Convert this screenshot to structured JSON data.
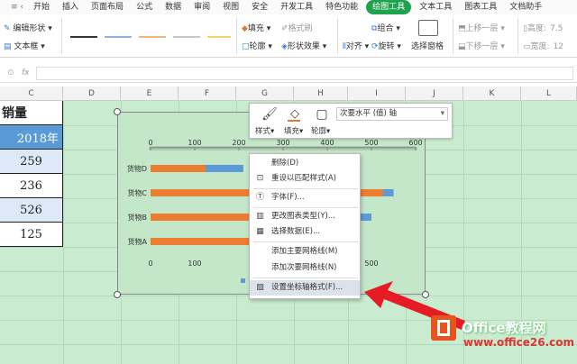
{
  "tabs": [
    "开始",
    "插入",
    "页面布局",
    "公式",
    "数据",
    "审阅",
    "视图",
    "安全",
    "开发工具",
    "特色功能",
    "绘图工具",
    "文本工具",
    "图表工具",
    "文档助手"
  ],
  "ribbon": {
    "edit_shape": "编辑形状",
    "text_box": "文本框",
    "fill": "填充",
    "format_brush": "格式刷",
    "outline": "轮廓",
    "shape_effects": "形状效果",
    "align": "对齐",
    "group": "组合",
    "rotate": "旋转",
    "selection_pane": "选择窗格",
    "bring_forward": "上移一层",
    "send_backward": "下移一层",
    "height_label": "高度:",
    "width_label": "宽度:",
    "height_val": "7.5",
    "width_val": "12"
  },
  "formula_bar": {
    "fx": "fx",
    "value": ""
  },
  "columns": [
    "C",
    "D",
    "E",
    "F",
    "G",
    "H",
    "I",
    "J",
    "K",
    "L"
  ],
  "sheet": {
    "header_partial": "销量",
    "year_header": "2018年",
    "values": [
      "259",
      "236",
      "526",
      "125"
    ]
  },
  "toolbar": {
    "style": "样式",
    "fill": "填充",
    "outline": "轮廓",
    "dropdown_value": "次要水平 (值) 轴"
  },
  "chart_data": {
    "type": "bar",
    "categories": [
      "货物D",
      "货物C",
      "货物B",
      "货物A"
    ],
    "series": [
      {
        "values": [
          125,
          526,
          236,
          259
        ],
        "color": "#ed7d31"
      },
      {
        "values": [
          210,
          550,
          500,
          0
        ],
        "color": "#5b9bd5"
      }
    ],
    "top_axis_ticks": [
      "0",
      "100",
      "200",
      "300",
      "400",
      "500",
      "600"
    ],
    "bottom_axis_ticks": [
      "0",
      "100",
      "500"
    ]
  },
  "context_menu": {
    "items": [
      "删除(D)",
      "重设以匹配样式(A)",
      "字体(F)...",
      "更改图表类型(Y)...",
      "选择数据(E)...",
      "添加主要网格线(M)",
      "添加次要网格线(N)",
      "设置坐标轴格式(F)..."
    ]
  },
  "watermark": {
    "brand": "Office教程网",
    "url": "www.office26.com"
  }
}
